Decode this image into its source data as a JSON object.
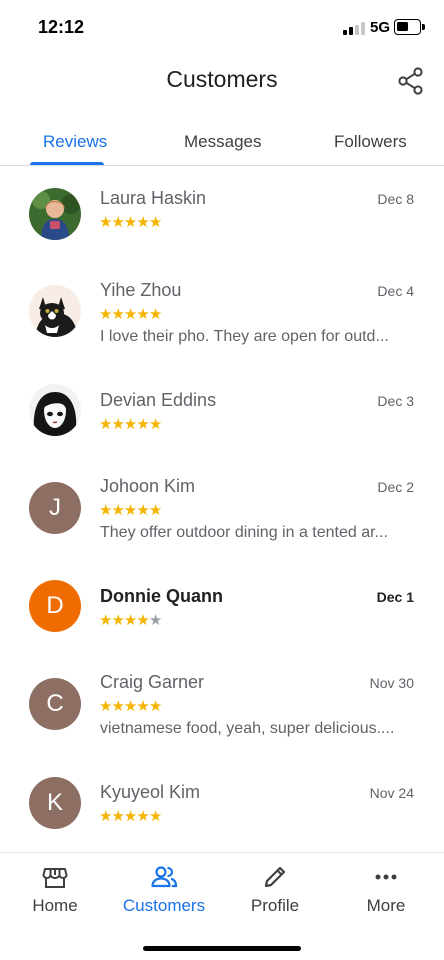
{
  "status_bar": {
    "time": "12:12",
    "network": "5G"
  },
  "header": {
    "title": "Customers",
    "share_icon": "share-icon"
  },
  "tabs": [
    {
      "label": "Reviews",
      "active": true
    },
    {
      "label": "Messages",
      "active": false
    },
    {
      "label": "Followers",
      "active": false
    }
  ],
  "reviews": [
    {
      "name": "Laura Haskin",
      "date": "Dec 8",
      "rating": 5,
      "text": "",
      "avatar": "photo",
      "unread": false
    },
    {
      "name": "Yihe Zhou",
      "date": "Dec 4",
      "rating": 5,
      "text": "I love their pho. They are open for outd...",
      "avatar": "photo",
      "unread": false
    },
    {
      "name": "Devian Eddins",
      "date": "Dec 3",
      "rating": 5,
      "text": "",
      "avatar": "photo",
      "unread": false
    },
    {
      "name": "Johoon Kim",
      "date": "Dec 2",
      "rating": 5,
      "text": "They offer outdoor dining in a tented ar...",
      "avatar_letter": "J",
      "avatar_color": "#8d6e63",
      "unread": false
    },
    {
      "name": "Donnie Quann",
      "date": "Dec 1",
      "rating": 4,
      "text": "",
      "avatar_letter": "D",
      "avatar_color": "#ef6c00",
      "unread": true
    },
    {
      "name": "Craig Garner",
      "date": "Nov 30",
      "rating": 5,
      "text": "vietnamese food, yeah, super delicious....",
      "avatar_letter": "C",
      "avatar_color": "#8d6e63",
      "unread": false
    },
    {
      "name": "Kyuyeol Kim",
      "date": "Nov 24",
      "rating": 5,
      "text": "",
      "avatar_letter": "K",
      "avatar_color": "#8d6e63",
      "unread": false
    }
  ],
  "bottom_nav": [
    {
      "label": "Home",
      "icon": "storefront-icon",
      "active": false
    },
    {
      "label": "Customers",
      "icon": "people-icon",
      "active": true
    },
    {
      "label": "Profile",
      "icon": "pencil-icon",
      "active": false
    },
    {
      "label": "More",
      "icon": "more-dots-icon",
      "active": false
    }
  ],
  "colors": {
    "accent": "#1a73e8",
    "star": "#f4b400",
    "star_empty": "#9aa0a6"
  }
}
